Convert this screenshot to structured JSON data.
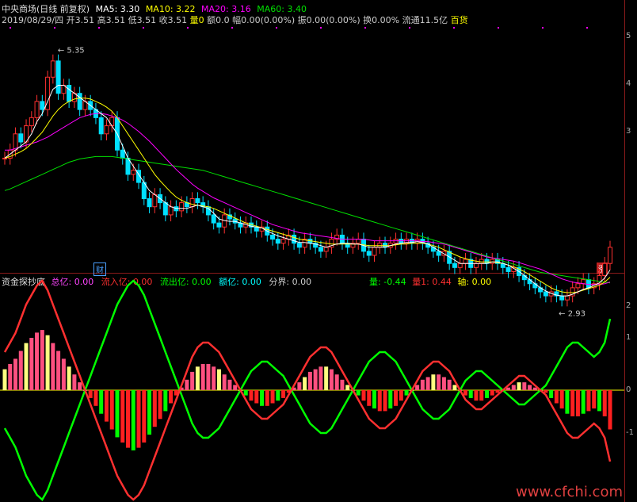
{
  "header": {
    "title": "中央商场(日线 前复权)",
    "ma5": {
      "label": "MA5: 3.30",
      "color": "#ffffff"
    },
    "ma10": {
      "label": "MA10: 3.22",
      "color": "#ffff00"
    },
    "ma20": {
      "label": "MA20: 3.16",
      "color": "#ff00ff"
    },
    "ma60": {
      "label": "MA60: 3.40",
      "color": "#00e000"
    },
    "date": "2019/08/29/四",
    "open": "开3.51",
    "high": "高3.51",
    "low": "低3.51",
    "close": "收3.51",
    "vol": "量0",
    "amount": "额0.0",
    "change": "幅0.00(0.00%)",
    "amplitude": "振0.00(0.00%)",
    "turnover": "换0.00%",
    "float": "流通11.5亿",
    "industry": "百货"
  },
  "indicator_header": {
    "name": "资金探抄底",
    "total": {
      "label": "总亿:",
      "value": "0.00",
      "color": "#ff44ff"
    },
    "inflow": {
      "label": "流入亿:",
      "value": "0.00",
      "color": "#ff3030"
    },
    "outflow": {
      "label": "流出亿:",
      "value": "0.00",
      "color": "#00ff00"
    },
    "amt": {
      "label": "额亿:",
      "value": "0.00",
      "color": "#00ffff"
    },
    "divide": {
      "label": "分界:",
      "value": "0.00",
      "color": "#cccccc"
    },
    "liang": {
      "label": "量:",
      "value": "-0.44",
      "color": "#00ff00"
    },
    "liang1": {
      "label": "量1:",
      "value": "0.44",
      "color": "#ff3030"
    },
    "axis": {
      "label": "轴:",
      "value": "0.00",
      "color": "#ffff00"
    }
  },
  "badges": {
    "cai": "财",
    "zhang": "涨"
  },
  "right_ticks": [
    "5",
    "4",
    "3",
    "2",
    "1",
    "0",
    "-1"
  ],
  "watermark": "www.cfchi.com",
  "chart_data": [
    {
      "type": "candlestick",
      "annotations": [
        {
          "text": "5.35",
          "kind": "high"
        },
        {
          "text": "2.93",
          "kind": "low"
        }
      ],
      "ylim": [
        2.7,
        5.5
      ],
      "close": [
        3.9,
        4.0,
        4.2,
        4.1,
        4.3,
        4.4,
        4.6,
        4.5,
        4.9,
        5.1,
        4.7,
        4.8,
        4.6,
        4.7,
        4.5,
        4.6,
        4.5,
        4.4,
        4.2,
        4.3,
        4.4,
        4.0,
        3.9,
        3.7,
        3.75,
        3.6,
        3.4,
        3.3,
        3.45,
        3.35,
        3.2,
        3.3,
        3.25,
        3.35,
        3.3,
        3.4,
        3.35,
        3.3,
        3.2,
        3.1,
        3.05,
        3.2,
        3.15,
        3.1,
        3.05,
        3.1,
        3.05,
        3.0,
        3.05,
        2.95,
        2.9,
        2.85,
        2.9,
        2.95,
        2.85,
        2.8,
        2.9,
        2.85,
        2.8,
        2.75,
        2.8,
        2.9,
        2.95,
        2.85,
        2.8,
        2.85,
        2.9,
        2.75,
        2.7,
        2.8,
        2.85,
        2.8,
        2.85,
        2.9,
        2.85,
        2.9,
        2.85,
        2.9,
        2.85,
        2.8,
        2.75,
        2.7,
        2.75,
        2.6,
        2.55,
        2.6,
        2.65,
        2.55,
        2.6,
        2.65,
        2.6,
        2.65,
        2.6,
        2.55,
        2.5,
        2.55,
        2.45,
        2.4,
        2.35,
        2.3,
        2.25,
        2.2,
        2.25,
        2.2,
        2.15,
        2.2,
        2.3,
        2.35,
        2.4,
        2.3,
        2.35,
        2.45,
        2.6,
        2.8
      ],
      "ma5": [
        3.9,
        3.95,
        4.0,
        4.05,
        4.1,
        4.2,
        4.35,
        4.45,
        4.6,
        4.75,
        4.8,
        4.8,
        4.75,
        4.7,
        4.65,
        4.6,
        4.55,
        4.5,
        4.45,
        4.4,
        4.3,
        4.2,
        4.05,
        3.9,
        3.8,
        3.7,
        3.6,
        3.5,
        3.45,
        3.4,
        3.35,
        3.3,
        3.28,
        3.28,
        3.28,
        3.3,
        3.32,
        3.3,
        3.28,
        3.22,
        3.15,
        3.13,
        3.12,
        3.12,
        3.1,
        3.08,
        3.06,
        3.05,
        3.04,
        3.0,
        2.97,
        2.94,
        2.92,
        2.9,
        2.88,
        2.86,
        2.86,
        2.85,
        2.84,
        2.82,
        2.8,
        2.82,
        2.84,
        2.85,
        2.85,
        2.84,
        2.84,
        2.82,
        2.8,
        2.8,
        2.8,
        2.8,
        2.82,
        2.84,
        2.85,
        2.86,
        2.86,
        2.87,
        2.86,
        2.84,
        2.8,
        2.76,
        2.72,
        2.68,
        2.64,
        2.6,
        2.6,
        2.6,
        2.6,
        2.6,
        2.6,
        2.62,
        2.62,
        2.6,
        2.58,
        2.54,
        2.5,
        2.45,
        2.4,
        2.35,
        2.3,
        2.26,
        2.23,
        2.21,
        2.2,
        2.2,
        2.22,
        2.25,
        2.28,
        2.3,
        2.33,
        2.36,
        2.42,
        2.52
      ],
      "ma10": [
        3.9,
        3.92,
        3.95,
        3.98,
        4.02,
        4.08,
        4.15,
        4.22,
        4.32,
        4.42,
        4.5,
        4.56,
        4.6,
        4.63,
        4.64,
        4.64,
        4.63,
        4.6,
        4.57,
        4.53,
        4.48,
        4.4,
        4.3,
        4.2,
        4.1,
        4.0,
        3.9,
        3.8,
        3.7,
        3.62,
        3.55,
        3.48,
        3.42,
        3.38,
        3.35,
        3.33,
        3.32,
        3.31,
        3.3,
        3.28,
        3.25,
        3.22,
        3.19,
        3.16,
        3.13,
        3.1,
        3.08,
        3.06,
        3.04,
        3.02,
        3.0,
        2.98,
        2.96,
        2.94,
        2.92,
        2.9,
        2.89,
        2.88,
        2.87,
        2.86,
        2.85,
        2.84,
        2.84,
        2.84,
        2.84,
        2.84,
        2.84,
        2.83,
        2.82,
        2.82,
        2.82,
        2.82,
        2.82,
        2.83,
        2.84,
        2.84,
        2.85,
        2.85,
        2.85,
        2.84,
        2.82,
        2.8,
        2.77,
        2.74,
        2.71,
        2.68,
        2.66,
        2.64,
        2.63,
        2.62,
        2.62,
        2.62,
        2.61,
        2.6,
        2.58,
        2.56,
        2.53,
        2.5,
        2.46,
        2.42,
        2.38,
        2.34,
        2.3,
        2.27,
        2.25,
        2.24,
        2.24,
        2.25,
        2.27,
        2.29,
        2.31,
        2.33,
        2.37,
        2.43
      ],
      "ma20": [
        4.0,
        4.0,
        4.02,
        4.04,
        4.06,
        4.08,
        4.1,
        4.13,
        4.16,
        4.2,
        4.24,
        4.28,
        4.32,
        4.36,
        4.4,
        4.42,
        4.44,
        4.45,
        4.45,
        4.44,
        4.42,
        4.4,
        4.37,
        4.33,
        4.28,
        4.23,
        4.17,
        4.11,
        4.04,
        3.97,
        3.9,
        3.83,
        3.76,
        3.7,
        3.64,
        3.58,
        3.53,
        3.49,
        3.45,
        3.41,
        3.38,
        3.35,
        3.32,
        3.29,
        3.26,
        3.23,
        3.2,
        3.17,
        3.14,
        3.11,
        3.08,
        3.06,
        3.04,
        3.02,
        3.0,
        2.98,
        2.97,
        2.96,
        2.95,
        2.94,
        2.93,
        2.92,
        2.91,
        2.9,
        2.9,
        2.9,
        2.9,
        2.9,
        2.89,
        2.88,
        2.88,
        2.88,
        2.88,
        2.88,
        2.88,
        2.88,
        2.88,
        2.88,
        2.87,
        2.87,
        2.86,
        2.85,
        2.84,
        2.82,
        2.8,
        2.78,
        2.76,
        2.74,
        2.72,
        2.7,
        2.68,
        2.67,
        2.66,
        2.65,
        2.64,
        2.63,
        2.61,
        2.59,
        2.57,
        2.55,
        2.53,
        2.5,
        2.47,
        2.44,
        2.41,
        2.39,
        2.37,
        2.36,
        2.35,
        2.34,
        2.34,
        2.34,
        2.35,
        2.37
      ],
      "ma60": [
        3.5,
        3.52,
        3.55,
        3.58,
        3.61,
        3.64,
        3.67,
        3.7,
        3.73,
        3.76,
        3.79,
        3.82,
        3.85,
        3.87,
        3.89,
        3.9,
        3.91,
        3.92,
        3.92,
        3.92,
        3.92,
        3.91,
        3.9,
        3.89,
        3.88,
        3.87,
        3.86,
        3.85,
        3.84,
        3.83,
        3.82,
        3.81,
        3.8,
        3.79,
        3.78,
        3.77,
        3.76,
        3.75,
        3.73,
        3.71,
        3.69,
        3.67,
        3.65,
        3.63,
        3.61,
        3.59,
        3.57,
        3.55,
        3.53,
        3.51,
        3.49,
        3.47,
        3.45,
        3.43,
        3.41,
        3.39,
        3.37,
        3.35,
        3.33,
        3.31,
        3.29,
        3.27,
        3.25,
        3.23,
        3.21,
        3.19,
        3.17,
        3.15,
        3.13,
        3.11,
        3.09,
        3.07,
        3.05,
        3.03,
        3.01,
        2.99,
        2.97,
        2.95,
        2.93,
        2.91,
        2.89,
        2.87,
        2.85,
        2.83,
        2.81,
        2.79,
        2.77,
        2.75,
        2.73,
        2.71,
        2.69,
        2.67,
        2.65,
        2.63,
        2.61,
        2.59,
        2.57,
        2.55,
        2.53,
        2.51,
        2.49,
        2.48,
        2.47,
        2.46,
        2.45,
        2.44,
        2.43,
        2.42,
        2.41,
        2.4,
        2.39,
        2.38,
        2.37,
        2.36
      ]
    },
    {
      "type": "bar",
      "series": [
        {
          "name": "量",
          "color": "#00ff00",
          "values": [
            -0.8,
            -1.0,
            -1.2,
            -1.5,
            -1.8,
            -2.0,
            -2.2,
            -2.3,
            -2.1,
            -1.8,
            -1.5,
            -1.2,
            -0.9,
            -0.6,
            -0.3,
            0,
            0.3,
            0.6,
            0.9,
            1.2,
            1.5,
            1.8,
            2.0,
            2.2,
            2.3,
            2.2,
            2.0,
            1.7,
            1.4,
            1.1,
            0.8,
            0.5,
            0.2,
            -0.1,
            -0.4,
            -0.7,
            -0.9,
            -1.0,
            -1.0,
            -0.9,
            -0.8,
            -0.6,
            -0.4,
            -0.2,
            0,
            0.2,
            0.4,
            0.5,
            0.6,
            0.6,
            0.5,
            0.4,
            0.3,
            0.1,
            -0.1,
            -0.3,
            -0.5,
            -0.7,
            -0.8,
            -0.9,
            -0.9,
            -0.8,
            -0.6,
            -0.4,
            -0.2,
            0,
            0.2,
            0.4,
            0.6,
            0.7,
            0.8,
            0.8,
            0.7,
            0.6,
            0.4,
            0.2,
            0,
            -0.2,
            -0.4,
            -0.5,
            -0.6,
            -0.6,
            -0.5,
            -0.4,
            -0.2,
            0,
            0.2,
            0.3,
            0.4,
            0.4,
            0.3,
            0.2,
            0.1,
            0,
            -0.1,
            -0.2,
            -0.3,
            -0.3,
            -0.2,
            -0.1,
            0,
            0.1,
            0.3,
            0.5,
            0.7,
            0.9,
            1.0,
            1.0,
            0.9,
            0.8,
            0.7,
            0.8,
            1.0,
            1.5
          ]
        },
        {
          "name": "量1",
          "color": "#ff3030",
          "values": [
            0.8,
            1.0,
            1.2,
            1.5,
            1.8,
            2.0,
            2.2,
            2.3,
            2.1,
            1.8,
            1.5,
            1.2,
            0.9,
            0.6,
            0.3,
            0,
            -0.3,
            -0.6,
            -0.9,
            -1.2,
            -1.5,
            -1.8,
            -2.0,
            -2.2,
            -2.3,
            -2.2,
            -2.0,
            -1.7,
            -1.4,
            -1.1,
            -0.8,
            -0.5,
            -0.2,
            0.1,
            0.4,
            0.7,
            0.9,
            1.0,
            1.0,
            0.9,
            0.8,
            0.6,
            0.4,
            0.2,
            0,
            -0.2,
            -0.4,
            -0.5,
            -0.6,
            -0.6,
            -0.5,
            -0.4,
            -0.3,
            -0.1,
            0.1,
            0.3,
            0.5,
            0.7,
            0.8,
            0.9,
            0.9,
            0.8,
            0.6,
            0.4,
            0.2,
            0,
            -0.2,
            -0.4,
            -0.6,
            -0.7,
            -0.8,
            -0.8,
            -0.7,
            -0.6,
            -0.4,
            -0.2,
            0,
            0.2,
            0.4,
            0.5,
            0.6,
            0.6,
            0.5,
            0.4,
            0.2,
            0,
            -0.2,
            -0.3,
            -0.4,
            -0.4,
            -0.3,
            -0.2,
            -0.1,
            0,
            0.1,
            0.2,
            0.3,
            0.3,
            0.2,
            0.1,
            0,
            -0.1,
            -0.3,
            -0.5,
            -0.7,
            -0.9,
            -1.0,
            -1.0,
            -0.9,
            -0.8,
            -0.7,
            -0.8,
            -1.0,
            -1.5
          ]
        }
      ]
    }
  ]
}
